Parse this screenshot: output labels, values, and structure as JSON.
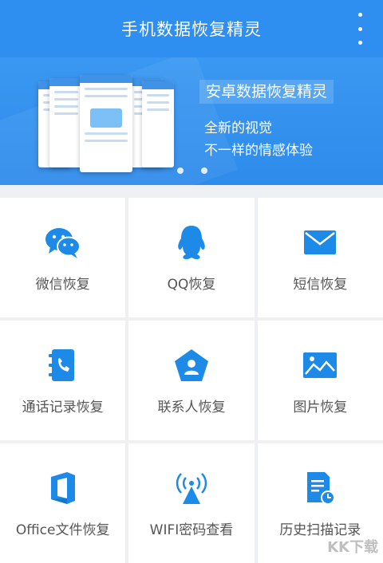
{
  "appbar": {
    "title": "手机数据恢复精灵",
    "menu_icon": "more-vertical-icon"
  },
  "banner": {
    "tag": "安卓数据恢复精灵",
    "line1": "全新的视觉",
    "line2": "不一样的情感体验",
    "page_count": 2,
    "active_page": 2
  },
  "features": [
    {
      "label": "微信恢复",
      "icon": "wechat-icon"
    },
    {
      "label": "QQ恢复",
      "icon": "qq-penguin-icon"
    },
    {
      "label": "短信恢复",
      "icon": "envelope-icon"
    },
    {
      "label": "通话记录恢复",
      "icon": "call-log-icon"
    },
    {
      "label": "联系人恢复",
      "icon": "contact-pentagon-icon"
    },
    {
      "label": "图片恢复",
      "icon": "image-icon"
    },
    {
      "label": "Office文件恢复",
      "icon": "office-icon"
    },
    {
      "label": "WIFI密码查看",
      "icon": "wifi-signal-icon"
    },
    {
      "label": "历史扫描记录",
      "icon": "history-document-icon"
    }
  ],
  "colors": {
    "primary": "#2f8ff0",
    "icon": "#1d8ae8",
    "label": "#555555"
  },
  "watermark": "KK下载"
}
